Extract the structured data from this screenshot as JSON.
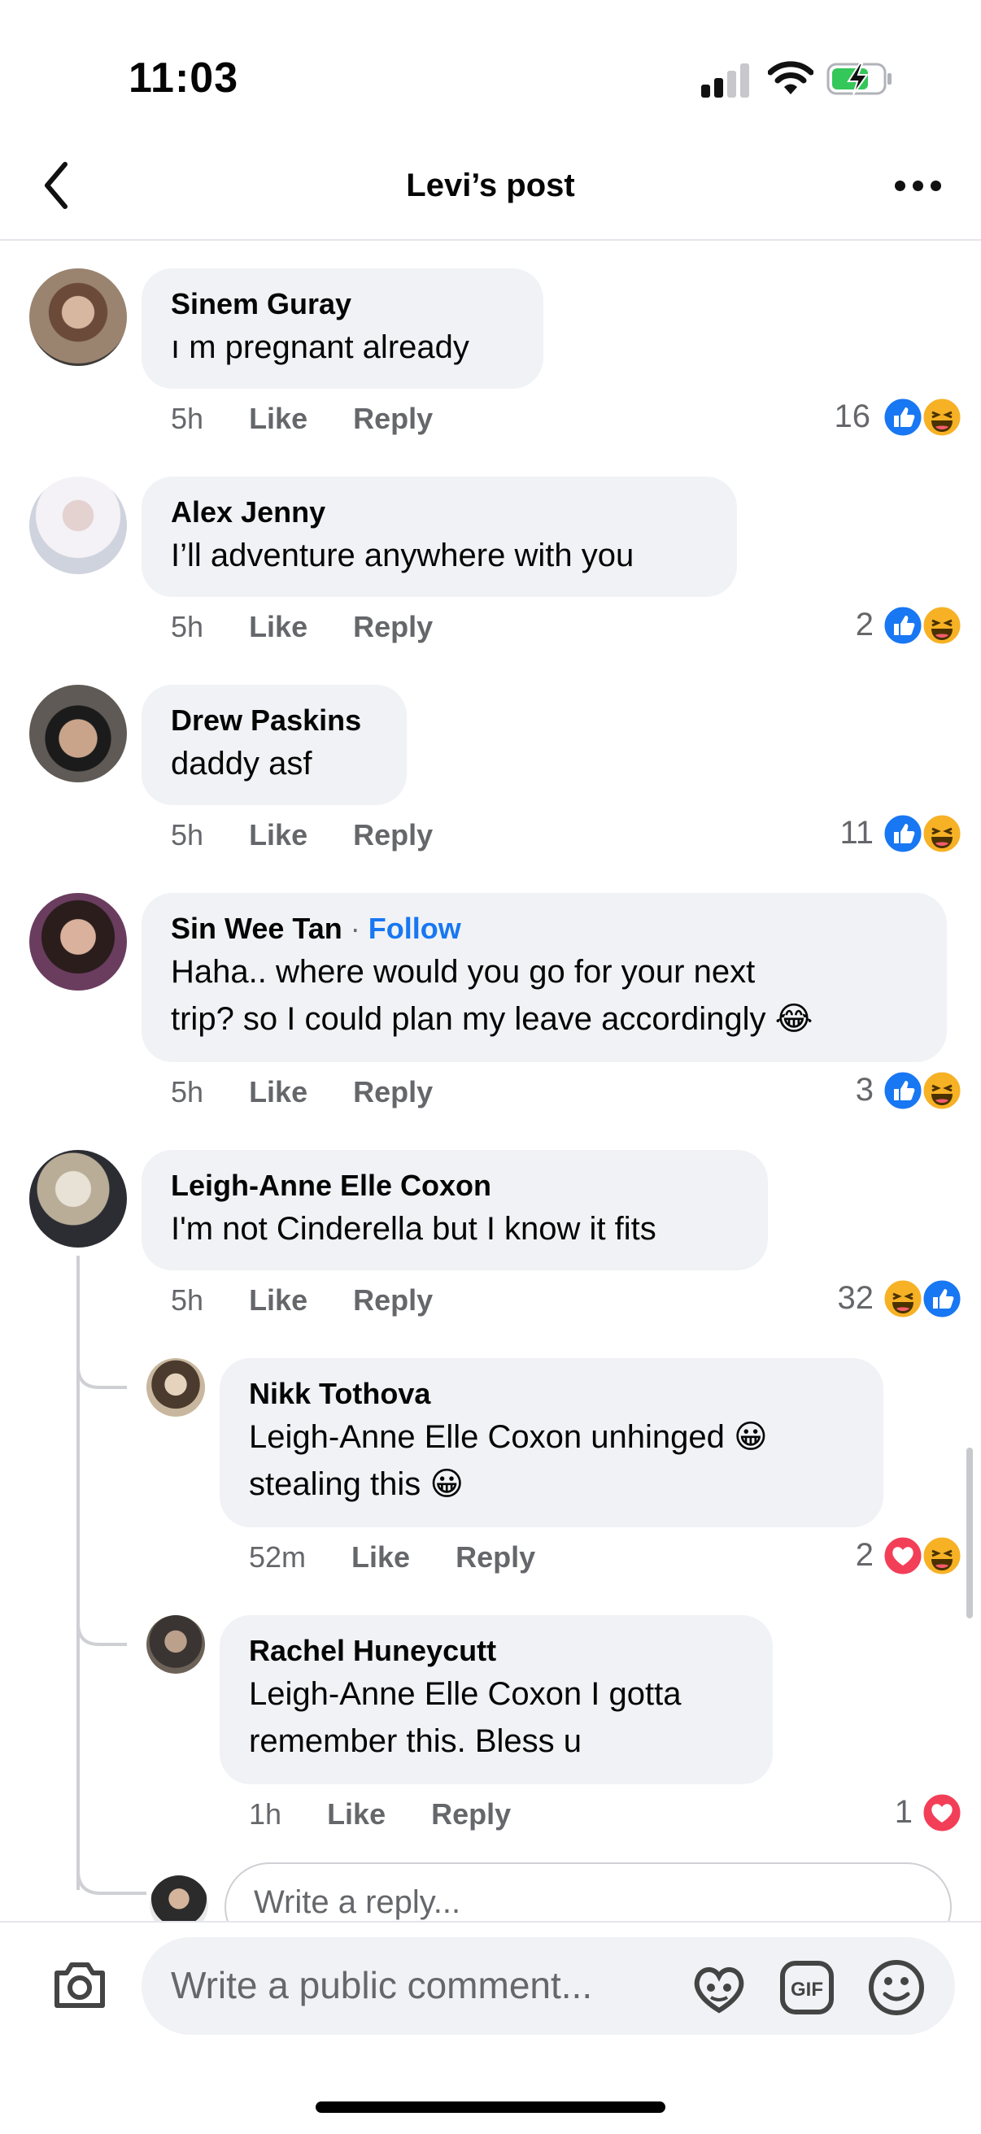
{
  "status": {
    "time": "11:03"
  },
  "header": {
    "title": "Levi’s post"
  },
  "comments": [
    {
      "name": "Sinem Guray",
      "lines": [
        "ı m pregnant already"
      ],
      "time": "5h",
      "like": "Like",
      "reply": "Reply",
      "count": "16"
    },
    {
      "name": "Alex Jenny",
      "lines": [
        "I’ll adventure anywhere with you"
      ],
      "time": "5h",
      "like": "Like",
      "reply": "Reply",
      "count": "2"
    },
    {
      "name": "Drew Paskins",
      "lines": [
        "daddy asf"
      ],
      "time": "5h",
      "like": "Like",
      "reply": "Reply",
      "count": "11"
    },
    {
      "name": "Sin Wee Tan",
      "follow_sep": "·",
      "follow": "Follow",
      "lines": [
        "Haha.. where would you go for your next",
        "trip? so I could plan my leave accordingly 😂"
      ],
      "time": "5h",
      "like": "Like",
      "reply": "Reply",
      "count": "3"
    },
    {
      "name": "Leigh-Anne Elle Coxon",
      "lines": [
        "I'm not Cinderella but I know it fits"
      ],
      "time": "5h",
      "like": "Like",
      "reply": "Reply",
      "count": "32"
    }
  ],
  "replies": [
    {
      "name": "Nikk Tothova",
      "lines": [
        "Leigh-Anne Elle Coxon unhinged 😀",
        "stealing this 😀"
      ],
      "time": "52m",
      "like": "Like",
      "reply": "Reply",
      "count": "2"
    },
    {
      "name": "Rachel Huneycutt",
      "lines": [
        "Leigh-Anne Elle Coxon I gotta",
        "remember this. Bless u"
      ],
      "time": "1h",
      "like": "Like",
      "reply": "Reply",
      "count": "1"
    }
  ],
  "reply_input": {
    "placeholder": "Write a reply..."
  },
  "comment_input": {
    "placeholder": "Write a public comment..."
  },
  "icons": [
    "back-icon",
    "more-icon",
    "camera-icon",
    "avatar-sticker-icon",
    "gif-icon",
    "emoji-icon",
    "like-reaction-icon",
    "haha-reaction-icon",
    "love-reaction-icon"
  ],
  "colors": {
    "accent": "#1877f2",
    "like": "#1877f2",
    "love": "#f33e58",
    "haha": "#f7b125",
    "bubble": "#f0f2f5",
    "meta": "#65676b"
  }
}
